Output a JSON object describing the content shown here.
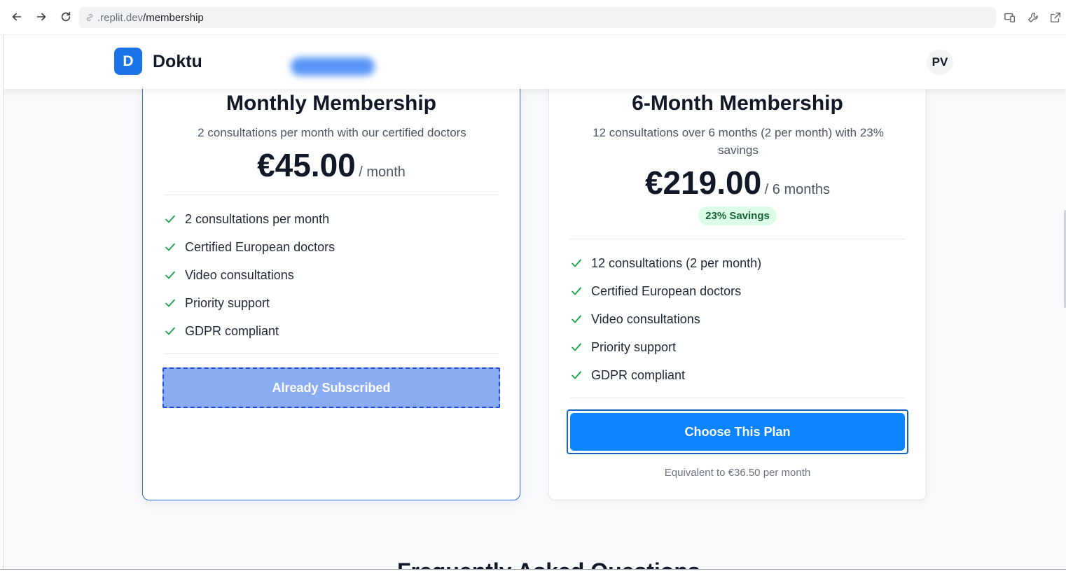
{
  "browser": {
    "url_host": ".replit.dev",
    "url_path": "/membership"
  },
  "header": {
    "logo_letter": "D",
    "app_name": "Doktu",
    "avatar_initials": "PV"
  },
  "plans": [
    {
      "title": "Monthly Membership",
      "description": "2 consultations per month with our certified doctors",
      "price": "€45.00",
      "period": "/ month",
      "features": [
        "2 consultations per month",
        "Certified European doctors",
        "Video consultations",
        "Priority support",
        "GDPR compliant"
      ],
      "button_label": "Already Subscribed"
    },
    {
      "title": "6-Month Membership",
      "description": "12 consultations over 6 months (2 per month) with 23% savings",
      "price": "€219.00",
      "period": "/ 6 months",
      "badge": "23% Savings",
      "features": [
        "12 consultations (2 per month)",
        "Certified European doctors",
        "Video consultations",
        "Priority support",
        "GDPR compliant"
      ],
      "button_label": "Choose This Plan",
      "footnote": "Equivalent to €36.50 per month"
    }
  ],
  "faq": {
    "heading": "Frequently Asked Questions"
  },
  "colors": {
    "primary": "#0a84ff",
    "brand": "#1a73e8",
    "check": "#16a34a",
    "badge_bg": "#dcfce7"
  }
}
